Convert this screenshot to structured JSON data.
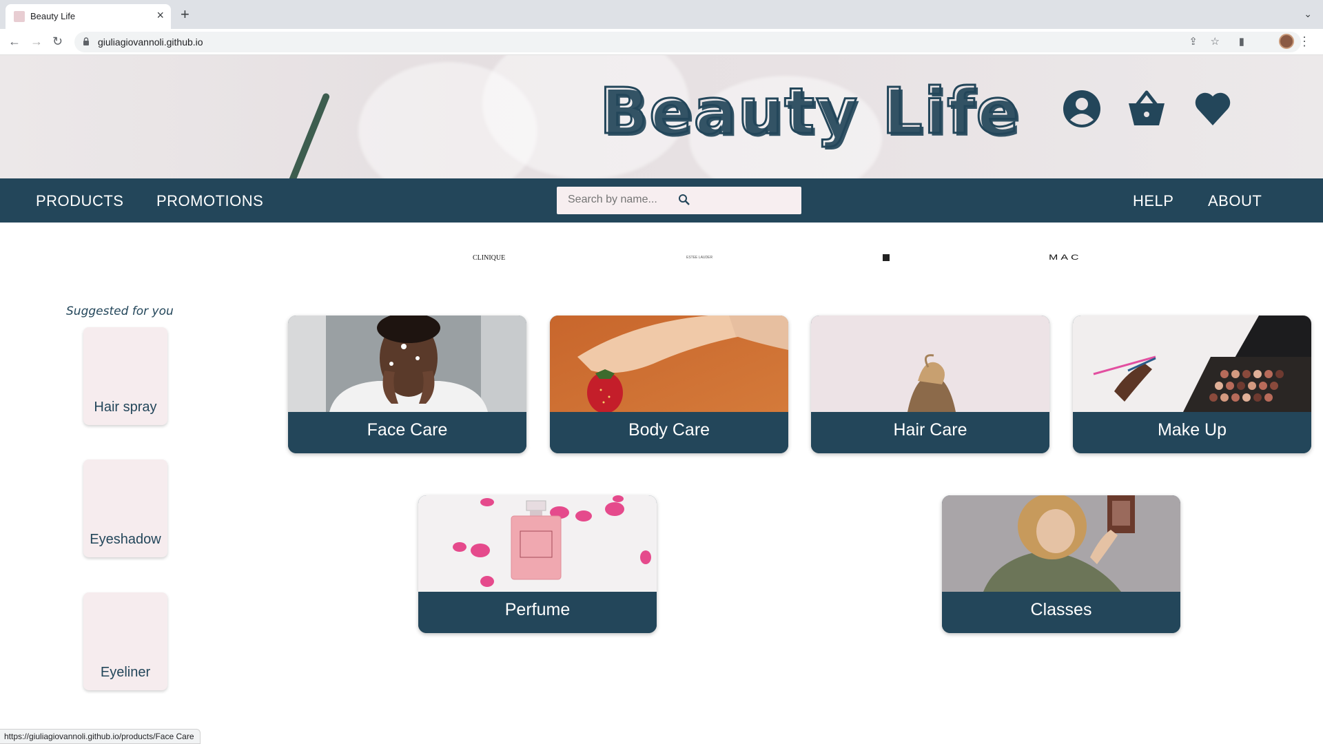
{
  "browser": {
    "tab_title": "Beauty Life",
    "url": "giuliagiovannoli.github.io",
    "status_url": "https://giuliagiovannoli.github.io/products/Face Care"
  },
  "header": {
    "site_title": "Beauty Life",
    "icons": [
      "user-icon",
      "basket-icon",
      "heart-icon"
    ]
  },
  "navbar": {
    "left_links": [
      "PRODUCTS",
      "PROMOTIONS"
    ],
    "right_links": [
      "HELP",
      "ABOUT"
    ],
    "search_placeholder": "Search by name..."
  },
  "brands": [
    "CLINIQUE",
    "ESTEE LAUDER",
    "MAC"
  ],
  "suggested": {
    "title": "Suggested for you",
    "items": [
      "Hair spray",
      "Eyeshadow",
      "Eyeliner"
    ]
  },
  "categories": [
    "Face Care",
    "Body Care",
    "Hair Care",
    "Make Up",
    "Perfume",
    "Classes"
  ],
  "colors": {
    "primary": "#23465a",
    "card_bg": "#f6ecee",
    "search_bg": "#f7eef0"
  }
}
